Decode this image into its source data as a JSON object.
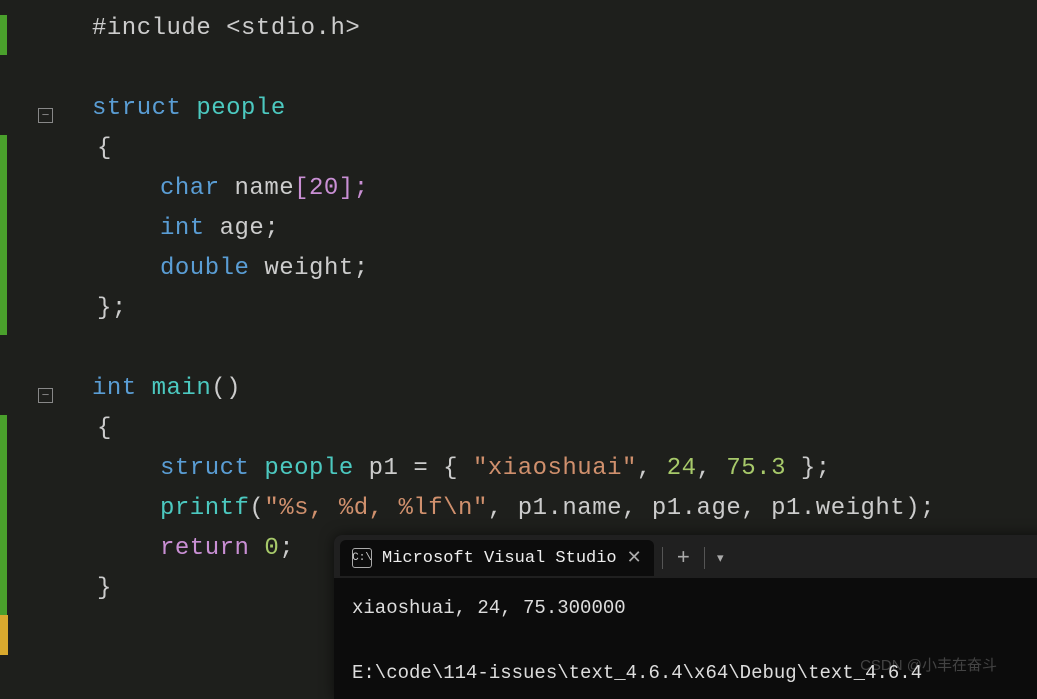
{
  "code": {
    "l1": {
      "include_kw": "#include",
      "include_hdr": "<stdio.h>"
    },
    "l3": {
      "kw": "struct",
      "name": "people"
    },
    "l4": {
      "brace": "{"
    },
    "l5": {
      "type": "char",
      "ident": "name",
      "dim": "[20];"
    },
    "l6": {
      "type": "int",
      "ident": "age",
      "semi": ";"
    },
    "l7": {
      "type": "double",
      "ident": "weight",
      "semi": ";"
    },
    "l8": {
      "brace": "};"
    },
    "l10": {
      "type": "int",
      "fn": "main",
      "paren": "()"
    },
    "l11": {
      "brace": "{"
    },
    "l12": {
      "kw": "struct",
      "type": "people",
      "var": "p1",
      "eq": " = { ",
      "s": "\"xiaoshuai\"",
      "c1": ", ",
      "n1": "24",
      "c2": ", ",
      "n2": "75.3",
      "end": " };"
    },
    "l13": {
      "fn": "printf",
      "open": "(",
      "s": "\"%s, %d, %lf\\n\"",
      "c1": ", ",
      "p1a": "p1.",
      "p1b": "name",
      "c2": ", ",
      "p2a": "p1.",
      "p2b": "age",
      "c3": ", ",
      "p3a": "p1.",
      "p3b": "weight",
      "close": ");"
    },
    "l14": {
      "kw": "return",
      "sp": " ",
      "n": "0",
      "semi": ";"
    },
    "l15": {
      "brace": "}"
    }
  },
  "terminal": {
    "tab_title": "Microsoft Visual Studio",
    "out1": "xiaoshuai, 24, 75.300000",
    "out2": "E:\\code\\114-issues\\text_4.6.4\\x64\\Debug\\text_4.6.4"
  },
  "watermark": "CSDN @小丰在奋斗"
}
